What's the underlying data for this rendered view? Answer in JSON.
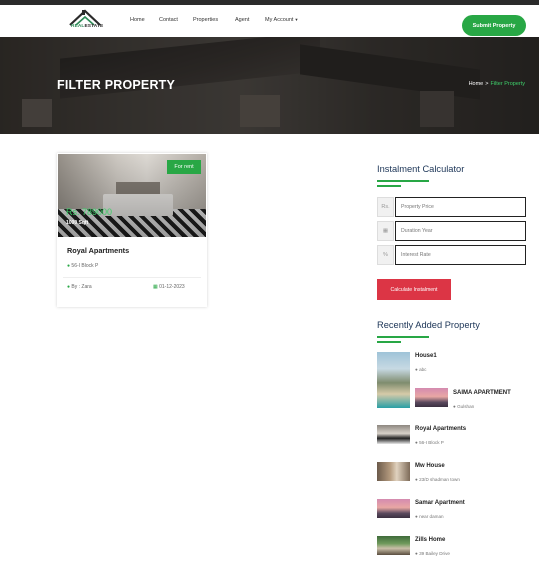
{
  "nav": {
    "logo": {
      "real": "REAL",
      "estate": "ESTATE"
    },
    "links": [
      "Home",
      "Contact",
      "Properties",
      "Agent",
      "My Account"
    ],
    "submit_label": "Submit Property"
  },
  "hero": {
    "title": "FILTER PROPERTY",
    "breadcrumb": {
      "home": "Home",
      "separator": ">",
      "current": "Filter Property"
    }
  },
  "listing": {
    "tag": "For rent",
    "price": "Rs. 789000",
    "area": "1000 Sqft",
    "title": "Royal Apartments",
    "location": "56-I Block P",
    "by": "By : Zara",
    "date": "01-12-2023"
  },
  "calculator": {
    "title": "Instalment Calculator",
    "fields": [
      {
        "icon": "Rs.",
        "icon_name": "currency-icon",
        "placeholder": "Property Price"
      },
      {
        "icon": "▦",
        "icon_name": "calendar-icon",
        "placeholder": "Duration Year"
      },
      {
        "icon": "%",
        "icon_name": "percent-icon",
        "placeholder": "Interest Rate"
      }
    ],
    "button_label": "Calculate Instalment"
  },
  "recent": {
    "title": "Recently Added Property",
    "items": [
      {
        "name": "House1",
        "location": "abc"
      },
      {
        "name": "SAIMA APARTMENT",
        "location": "Gulshan"
      },
      {
        "name": "Royal Apartments",
        "location": "56-I Block P"
      },
      {
        "name": "Mw House",
        "location": "23/D shadman town"
      },
      {
        "name": "Samar Apartment",
        "location": "near daman"
      },
      {
        "name": "Zills Home",
        "location": "39 Bailey Drive"
      }
    ]
  },
  "colors": {
    "accent_green": "#28a745",
    "danger_red": "#dc3545",
    "heading_navy": "#1c3557",
    "topbar": "#2b2b2b"
  }
}
